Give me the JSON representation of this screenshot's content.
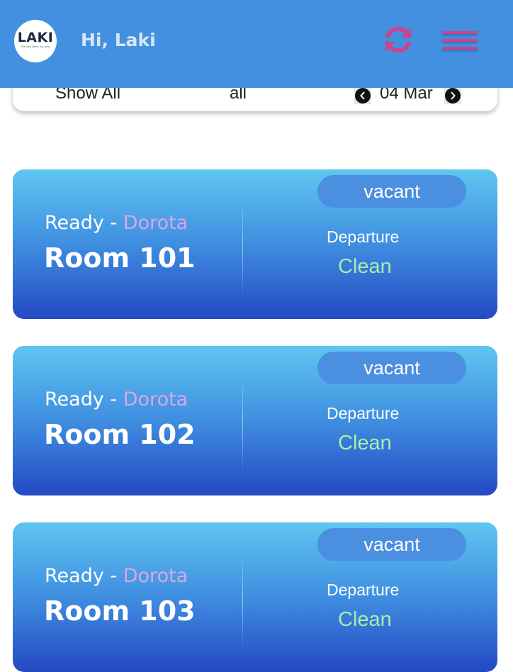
{
  "header": {
    "logo_text": "LAKI",
    "logo_tagline": "We are here for you",
    "greeting": "Hi, Laki",
    "refresh_icon": "refresh-icon",
    "menu_icon": "hamburger-menu-icon",
    "background_color": "#4390e0",
    "accent_color": "#c7468c"
  },
  "filters": {
    "show_all_label": "Show All",
    "status_filter": "all",
    "date_label": "04 Mar",
    "prev_icon": "chevron-left-icon",
    "next_icon": "chevron-right-icon"
  },
  "rooms": [
    {
      "status_label": "Ready",
      "separator": " - ",
      "staff": "Dorota",
      "room": "Room 101",
      "occupancy": "vacant",
      "type": "Departure",
      "condition": "Clean"
    },
    {
      "status_label": "Ready",
      "separator": " - ",
      "staff": "Dorota",
      "room": "Room 102",
      "occupancy": "vacant",
      "type": "Departure",
      "condition": "Clean"
    },
    {
      "status_label": "Ready",
      "separator": " - ",
      "staff": "Dorota",
      "room": "Room 103",
      "occupancy": "vacant",
      "type": "Departure",
      "condition": "Clean"
    }
  ],
  "colors": {
    "staff_name": "#e0a2e8",
    "clean_status": "#a8ecb0",
    "card_gradient_top": "#5ec6f0",
    "card_gradient_bottom": "#2548c4"
  }
}
